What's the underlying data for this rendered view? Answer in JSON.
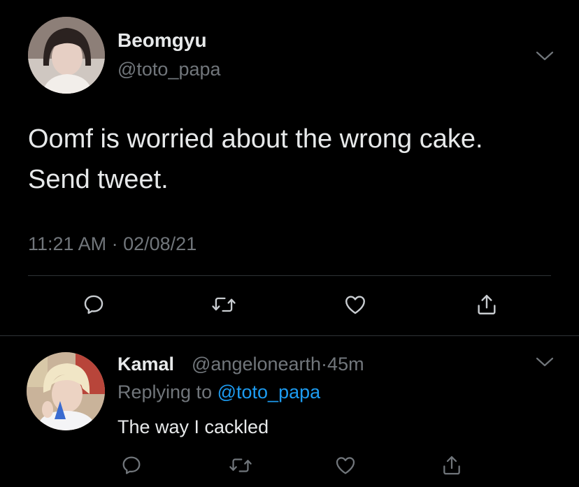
{
  "tweet": {
    "author": {
      "display_name": "Beomgyu",
      "handle": "@toto_papa"
    },
    "text_lines": [
      "Oomf is worried about the wrong cake.",
      "Send tweet."
    ],
    "time": "11:21 AM",
    "separator": "·",
    "date": "02/08/21",
    "actions": [
      "reply-icon",
      "retweet-icon",
      "like-icon",
      "share-icon"
    ]
  },
  "reply": {
    "author": {
      "display_name": "Kamal",
      "handle": "@angelonearth"
    },
    "separator": "·",
    "age": "45m",
    "replying_prefix": "Replying to",
    "replying_to": "@toto_papa",
    "text": "The way I cackled",
    "actions": [
      "reply-icon",
      "retweet-icon",
      "like-icon",
      "share-icon"
    ]
  },
  "colors": {
    "background": "#000000",
    "primary_text": "#e7e9ea",
    "secondary_text": "#71767b",
    "link": "#1d9bf0",
    "divider": "#2f3336"
  }
}
